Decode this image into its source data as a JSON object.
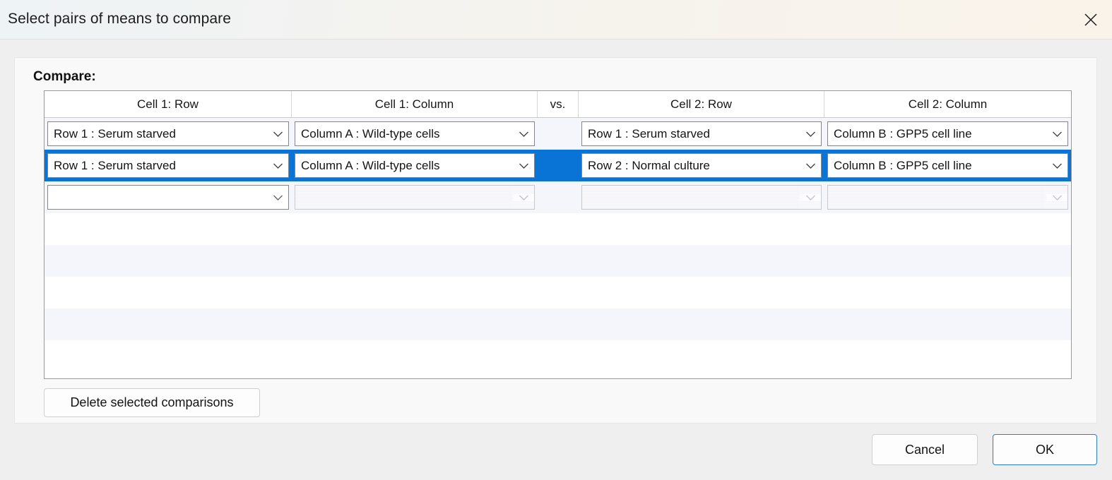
{
  "titlebar": {
    "title": "Select pairs of means to compare",
    "close_icon": "close-icon"
  },
  "panel": {
    "compare_label": "Compare:"
  },
  "grid": {
    "headers": [
      "Cell 1: Row",
      "Cell 1: Column",
      "vs.",
      "Cell 2: Row",
      "Cell 2: Column"
    ],
    "rows": [
      {
        "selected": false,
        "cell1_row": "Row 1 : Serum starved",
        "cell1_col": "Column A : Wild-type cells",
        "cell2_row": "Row 1 : Serum starved",
        "cell2_col": "Column B : GPP5 cell line",
        "disabled": false
      },
      {
        "selected": true,
        "cell1_row": "Row 1 : Serum starved",
        "cell1_col": "Column A : Wild-type cells",
        "cell2_row": "Row 2 : Normal culture",
        "cell2_col": "Column B : GPP5 cell line",
        "disabled": false
      },
      {
        "selected": false,
        "cell1_row": "",
        "cell1_col": "",
        "cell2_row": "",
        "cell2_col": "",
        "disabled": true
      }
    ],
    "empty_row_count": 5
  },
  "buttons": {
    "delete": "Delete selected comparisons",
    "cancel": "Cancel",
    "ok": "OK"
  },
  "colors": {
    "selection_blue": "#0a74d6",
    "default_button_border": "#2a7ccd",
    "stripe": "#f5f5fc"
  }
}
